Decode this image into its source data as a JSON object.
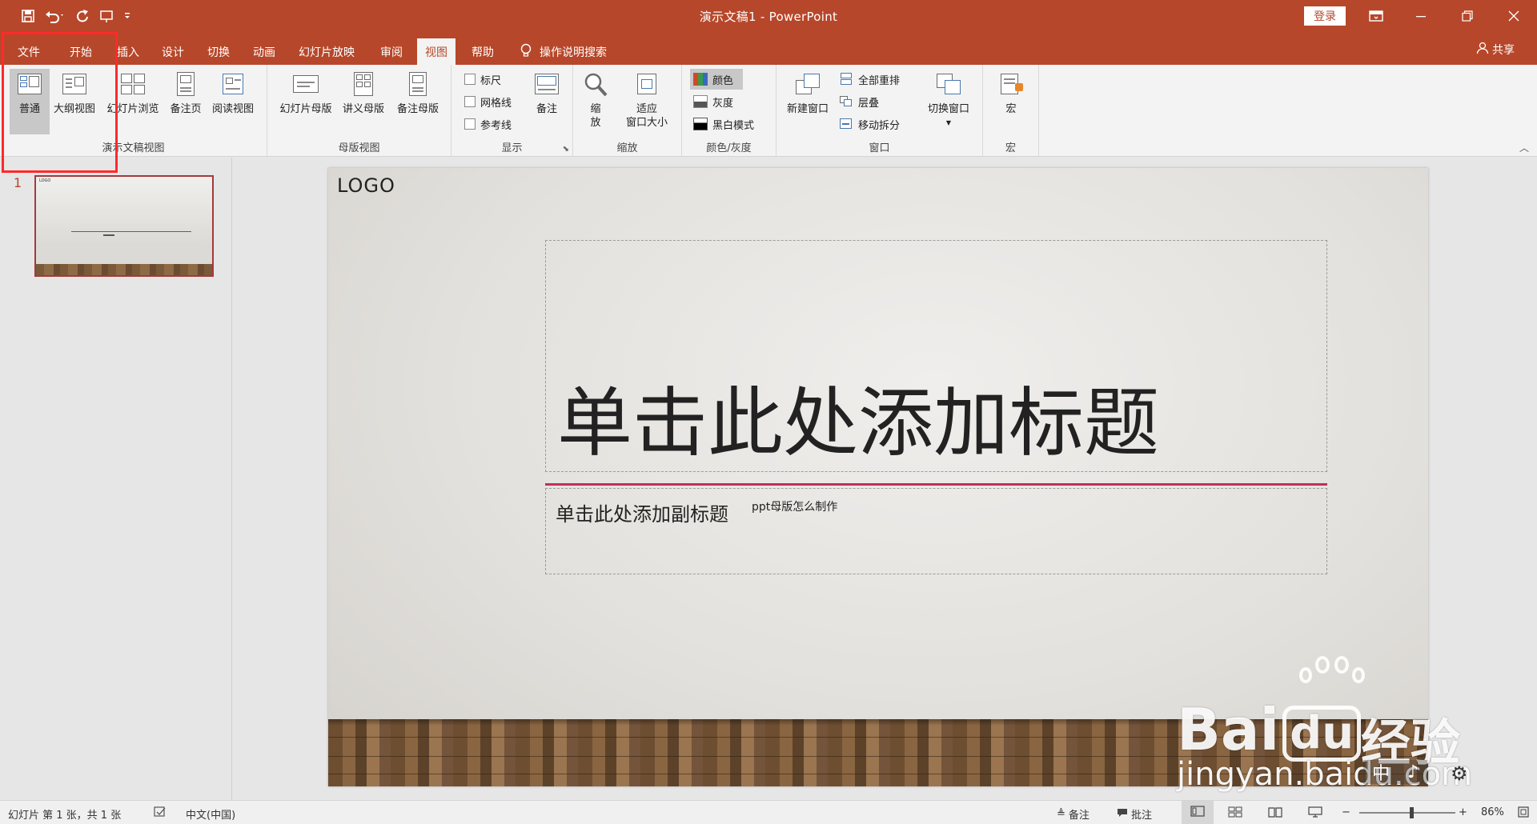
{
  "app": {
    "title": "演示文稿1  -  PowerPoint",
    "login_label": "登录",
    "share_label": "共享"
  },
  "colors": {
    "brand": "#b7472a",
    "accent_line": "#c0305a",
    "highlight": "#ff2a2a"
  },
  "tabs": [
    {
      "label": "文件"
    },
    {
      "label": "开始"
    },
    {
      "label": "插入"
    },
    {
      "label": "设计"
    },
    {
      "label": "切换"
    },
    {
      "label": "动画"
    },
    {
      "label": "幻灯片放映"
    },
    {
      "label": "审阅"
    },
    {
      "label": "视图",
      "active": true
    },
    {
      "label": "帮助"
    }
  ],
  "tell_me": "操作说明搜索",
  "ribbon": {
    "presentation_views": {
      "label": "演示文稿视图",
      "normal": "普通",
      "outline": "大纲视图",
      "sorter": "幻灯片浏览",
      "notes_page": "备注页",
      "reading": "阅读视图"
    },
    "master_views": {
      "label": "母版视图",
      "slide_master": "幻灯片母版",
      "handout_master": "讲义母版",
      "notes_master": "备注母版"
    },
    "show": {
      "label": "显示",
      "ruler": "标尺",
      "gridlines": "网格线",
      "guides": "参考线",
      "notes": "备注"
    },
    "zoom": {
      "label": "缩放",
      "zoom_line1": "缩",
      "zoom_line2": "放",
      "fit_line1": "适应",
      "fit_line2": "窗口大小"
    },
    "color": {
      "label": "颜色/灰度",
      "color": "颜色",
      "grayscale": "灰度",
      "bw": "黑白模式"
    },
    "window": {
      "label": "窗口",
      "new_window": "新建窗口",
      "arrange_all": "全部重排",
      "cascade": "层叠",
      "move_split": "移动拆分",
      "switch_windows": "切换窗口"
    },
    "macros": {
      "label": "宏",
      "macros": "宏"
    }
  },
  "thumbnails": [
    {
      "number": "1",
      "logo": "LOGO"
    }
  ],
  "slide": {
    "logo": "LOGO",
    "title": "单击此处添加标题",
    "subtitle": "单击此处添加副标题",
    "subtitle_note": "ppt母版怎么制作"
  },
  "watermark": {
    "brand": "Bai",
    "brand_du": "du",
    "brand_cn": "经验",
    "url": "jingyan.baidu.com"
  },
  "ime": {
    "lang": "中",
    "mode": "♪"
  },
  "statusbar": {
    "slide_info": "幻灯片 第 1 张，共 1 张",
    "language": "中文(中国)",
    "notes": "备注",
    "comments": "批注",
    "zoom": "86%",
    "zoom_level": 0.54
  }
}
